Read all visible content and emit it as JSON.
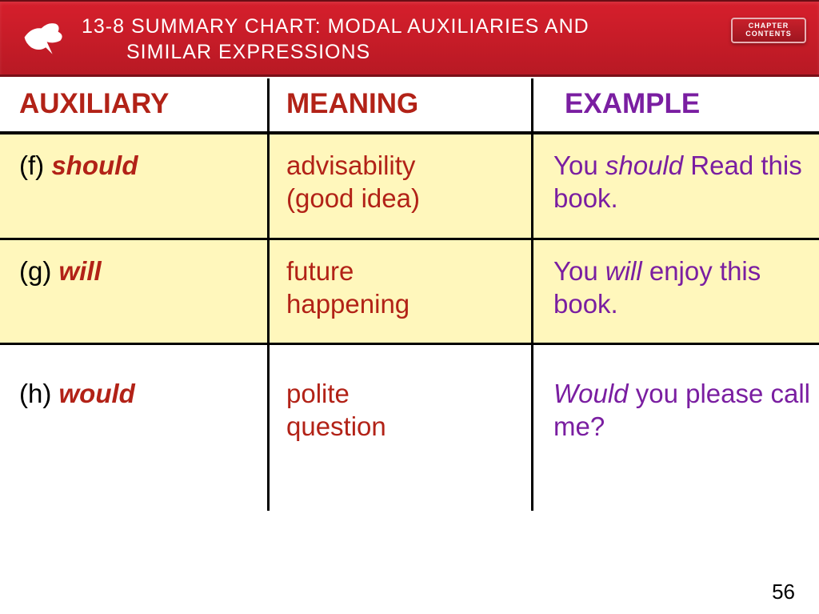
{
  "header": {
    "title_line1": "13-8 SUMMARY CHART: MODAL AUXILIARIES AND",
    "title_line2": "SIMILAR EXPRESSIONS",
    "chapter_btn_l1": "CHAPTER",
    "chapter_btn_l2": "CONTENTS"
  },
  "columns": {
    "auxiliary": "AUXILIARY",
    "meaning": "MEANING",
    "example": "EXAMPLE"
  },
  "rows": [
    {
      "letter": "(f) ",
      "modal": "should",
      "meaning_l1": "advisability",
      "meaning_l2": "(good idea)",
      "example_pre": "You ",
      "example_em": "should",
      "example_post": " Read this book."
    },
    {
      "letter": "(g) ",
      "modal": "will",
      "meaning_l1": "future",
      "meaning_l2": "happening",
      "example_pre": "You ",
      "example_em": "will",
      "example_post": " enjoy this book."
    },
    {
      "letter": "(h) ",
      "modal": "would",
      "meaning_l1": "polite",
      "meaning_l2": "question",
      "example_pre": "",
      "example_em": "Would",
      "example_post": " you please call me?"
    }
  ],
  "page_number": "56"
}
